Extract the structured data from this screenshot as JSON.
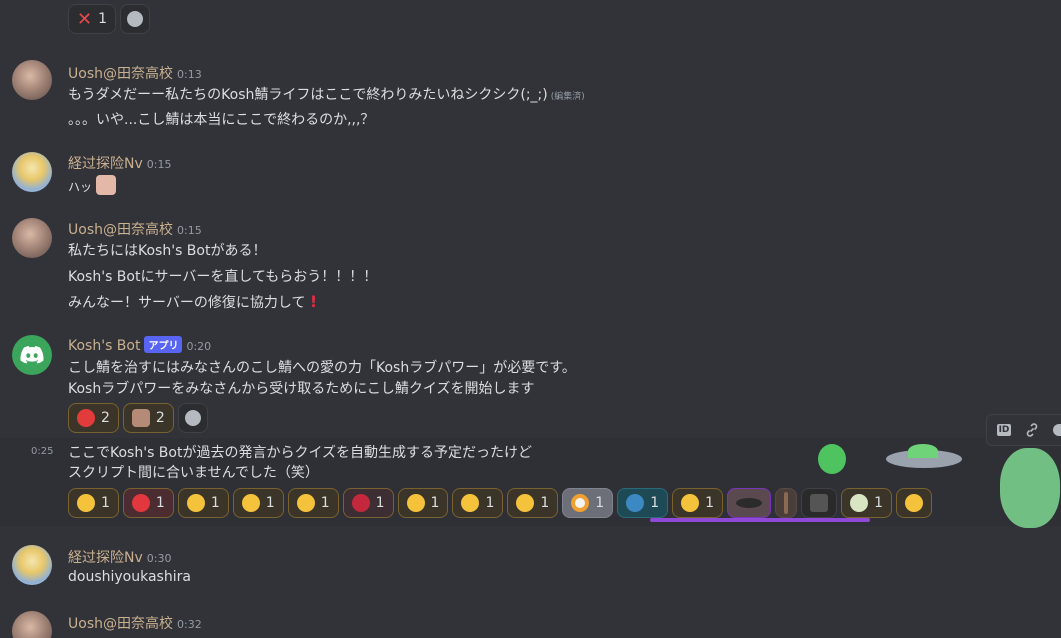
{
  "top_reactions": [
    {
      "emoji": "cross-mark",
      "count": "1"
    }
  ],
  "messages": [
    {
      "author": "Uosh@田奈高校",
      "time": "0:13",
      "lines": [
        "もうダメだーー私たちのKosh鯖ライフはここで終わりみたいねシクシク(;_;)",
        "。。。いや...こし鯖は本当にここで終わるのか,,,？"
      ],
      "edited": "(編集済)"
    },
    {
      "author": "経过探险Nv",
      "time": "0:15",
      "lines": [
        "ハッ"
      ]
    },
    {
      "author": "Uosh@田奈高校",
      "time": "0:15",
      "lines": [
        "私たちにはKosh's Botがある！",
        "Kosh's Botにサーバーを直してもらおう！！！！",
        "みんなー！サーバーの修復に協力して"
      ]
    },
    {
      "author": "Kosh's Bot",
      "badge": "アプリ",
      "time": "0:20",
      "lines": [
        "こし鯖を治すにはみなさんのこし鯖への愛の力「Koshラブパワー」が必要です。",
        "Koshラブパワーをみなさんから受け取るためにこし鯖クイズを開始します"
      ],
      "reactions": [
        {
          "emoji": "red-blob",
          "count": "2"
        },
        {
          "emoji": "face-sticker",
          "count": "2"
        }
      ]
    },
    {
      "time": "0:25",
      "lines": [
        "ここでKosh's Botが過去の発言からクイズを自動生成する予定だったけど",
        "スクリプト間に合いませんでした（笑）"
      ],
      "reactions": [
        {
          "emoji": "pleading-face",
          "count": "1"
        },
        {
          "emoji": "angry-face",
          "count": "1"
        },
        {
          "emoji": "confounded-face",
          "count": "1"
        },
        {
          "emoji": "upside-down-face",
          "count": "1"
        },
        {
          "emoji": "grinning-face",
          "count": "1"
        },
        {
          "emoji": "angry-blob",
          "count": "1"
        },
        {
          "emoji": "thinking-tear-face",
          "count": "1"
        },
        {
          "emoji": "sweat-smile-face",
          "count": "1"
        },
        {
          "emoji": "grimacing-face",
          "count": "1"
        },
        {
          "emoji": "fried-egg",
          "count": "1"
        },
        {
          "emoji": "globe",
          "count": "1"
        },
        {
          "emoji": "smiling-face",
          "count": "1"
        },
        {
          "emoji": "eye-sticker",
          "count": ""
        },
        {
          "emoji": "brush-sticker",
          "count": ""
        },
        {
          "emoji": "image-sticker",
          "count": ""
        },
        {
          "emoji": "anime-face",
          "count": "1"
        },
        {
          "emoji": "smirk-face",
          "count": ""
        }
      ]
    },
    {
      "author": "経过探险Nv",
      "time": "0:30",
      "lines": [
        "doushiyoukashira"
      ]
    },
    {
      "author": "Uosh@田奈高校",
      "time": "0:32",
      "lines": [
        ""
      ]
    }
  ],
  "toolbar": {
    "items": [
      "id-icon",
      "link-icon",
      "thread-icon"
    ]
  }
}
